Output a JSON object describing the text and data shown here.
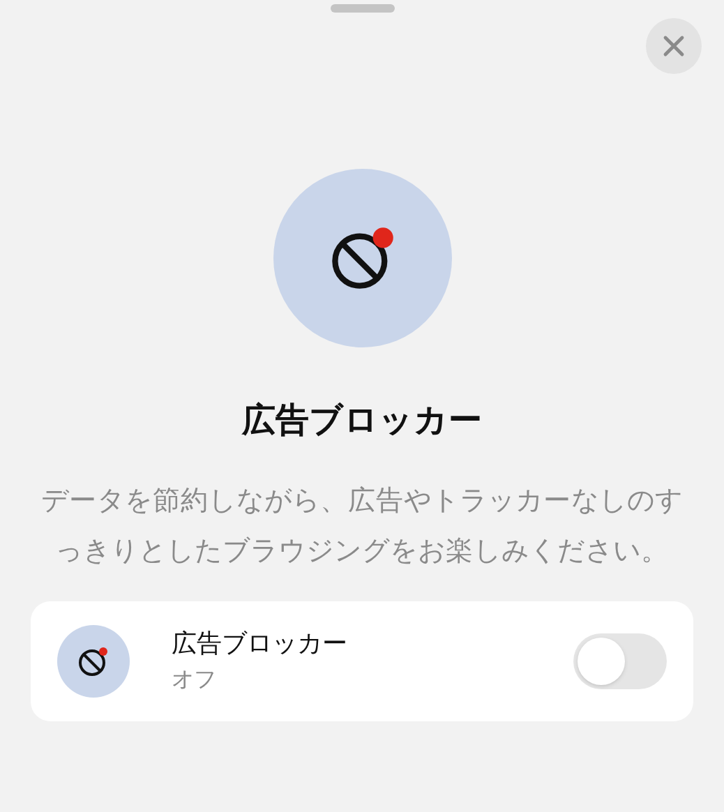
{
  "sheet": {
    "title": "広告ブロッカー",
    "description": "データを節約しながら、広告やトラッカーなしのすっきりとしたブラウジングをお楽しみください。"
  },
  "setting": {
    "label": "広告ブロッカー",
    "status": "オフ",
    "on": false
  }
}
